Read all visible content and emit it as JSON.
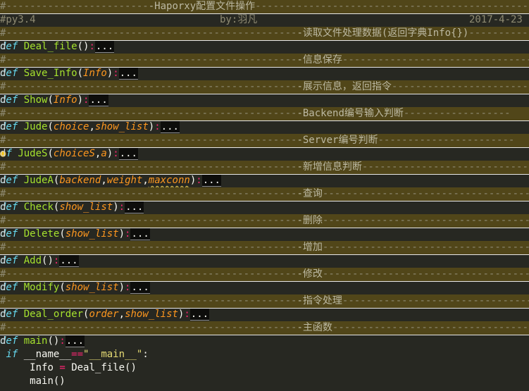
{
  "header": {
    "title": "-Haporxy配置文件操作",
    "version": "#py3.4",
    "author": "by:羽凡",
    "date": "2017-4-23"
  },
  "sections": {
    "read": "-读取文件处理数据(返回字典Info{})",
    "save": "-信息保存",
    "show": "-展示信息，返回指令",
    "backend": "-Backend编号输入判断",
    "server": "-Server编号判断",
    "add_judge": "-新增信息判断",
    "query": "-查询",
    "delete": "-删除",
    "add": "-增加",
    "modify": "-修改",
    "order": "-指令处理",
    "main": "-主函数"
  },
  "code": {
    "kw_def": "def",
    "kw_if": "if",
    "ellipsis": "...",
    "hash": "#",
    "fn_deal_file": "Deal_file",
    "fn_save_info": "Save_Info",
    "fn_show": "Show",
    "fn_jude": "Jude",
    "fn_judes": "JudeS",
    "fn_judea": "JudeA",
    "fn_check": "Check",
    "fn_delete": "Delete",
    "fn_add": "Add",
    "fn_modify": "Modify",
    "fn_deal_order": "Deal_order",
    "fn_main": "main",
    "p_info": "Info",
    "p_choice": "choice",
    "p_show_list": "show_list",
    "p_choices": "choiceS",
    "p_a": "a",
    "p_backend": "backend",
    "p_weight": "weight",
    "p_maxconn": "maxconn",
    "p_order": "order",
    "dunder_name": "__name__",
    "op_eq": "==",
    "str_main": "\"__main__\"",
    "var_info": "Info",
    "op_assign": "=",
    "call_deal_file": "Deal_file()",
    "call_main": "main()"
  },
  "icons": {
    "bulb": "lightbulb-icon"
  },
  "colors": {
    "background": "#272822",
    "comment_band": "#514619",
    "keyword": "#66d9ef",
    "function": "#a6e22e",
    "param": "#fd971f",
    "operator": "#f92672",
    "string": "#e6db74"
  }
}
